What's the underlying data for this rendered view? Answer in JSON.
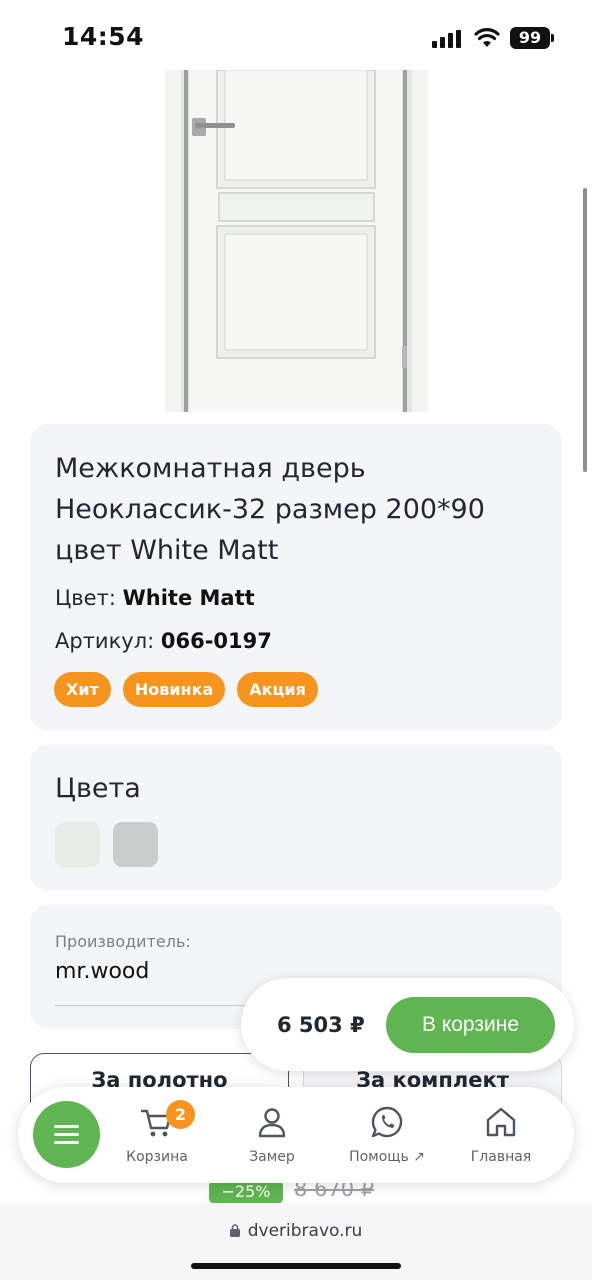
{
  "status_bar": {
    "time": "14:54",
    "battery": "99"
  },
  "product": {
    "title": "Межкомнатная дверь Неоклассик-32 размер 200*90 цвет White Matt",
    "color_label": "Цвет:",
    "color_value": "White Matt",
    "sku_label": "Артикул:",
    "sku_value": "066-0197",
    "tags": [
      "Хит",
      "Новинка",
      "Акция"
    ]
  },
  "colors": {
    "title": "Цвета",
    "swatches": [
      "#e9ebe7",
      "#cacdcb"
    ]
  },
  "manufacturer": {
    "label": "Производитель:",
    "value": "mr.wood"
  },
  "pricing_tabs": [
    "За полотно",
    "За комплект"
  ],
  "price_popup": {
    "price": "6 503 ₽",
    "button_label": "В корзине"
  },
  "old_price": {
    "discount": "−25%",
    "value": "8 670 ₽"
  },
  "bottom_nav": {
    "cart_badge": "2",
    "items": [
      {
        "label": "Корзина",
        "icon": "cart-icon"
      },
      {
        "label": "Замер",
        "icon": "user-icon"
      },
      {
        "label": "Помощь ↗",
        "icon": "whatsapp-icon"
      },
      {
        "label": "Главная",
        "icon": "home-icon"
      }
    ]
  },
  "browser": {
    "url": "dveribravo.ru"
  },
  "colors_theme": {
    "accent_green": "#5fb551",
    "badge_orange": "#f7941d",
    "card_bg": "#f4f5f7"
  }
}
